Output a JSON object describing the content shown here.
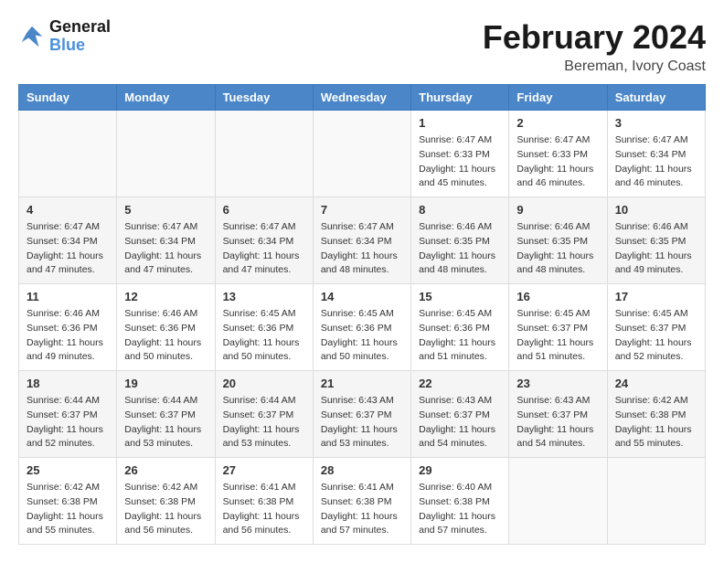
{
  "header": {
    "logo_line1": "General",
    "logo_line2": "Blue",
    "main_title": "February 2024",
    "subtitle": "Bereman, Ivory Coast"
  },
  "calendar": {
    "columns": [
      "Sunday",
      "Monday",
      "Tuesday",
      "Wednesday",
      "Thursday",
      "Friday",
      "Saturday"
    ],
    "weeks": [
      [
        {
          "day": "",
          "info": ""
        },
        {
          "day": "",
          "info": ""
        },
        {
          "day": "",
          "info": ""
        },
        {
          "day": "",
          "info": ""
        },
        {
          "day": "1",
          "info": "Sunrise: 6:47 AM\nSunset: 6:33 PM\nDaylight: 11 hours\nand 45 minutes."
        },
        {
          "day": "2",
          "info": "Sunrise: 6:47 AM\nSunset: 6:33 PM\nDaylight: 11 hours\nand 46 minutes."
        },
        {
          "day": "3",
          "info": "Sunrise: 6:47 AM\nSunset: 6:34 PM\nDaylight: 11 hours\nand 46 minutes."
        }
      ],
      [
        {
          "day": "4",
          "info": "Sunrise: 6:47 AM\nSunset: 6:34 PM\nDaylight: 11 hours\nand 47 minutes."
        },
        {
          "day": "5",
          "info": "Sunrise: 6:47 AM\nSunset: 6:34 PM\nDaylight: 11 hours\nand 47 minutes."
        },
        {
          "day": "6",
          "info": "Sunrise: 6:47 AM\nSunset: 6:34 PM\nDaylight: 11 hours\nand 47 minutes."
        },
        {
          "day": "7",
          "info": "Sunrise: 6:47 AM\nSunset: 6:34 PM\nDaylight: 11 hours\nand 48 minutes."
        },
        {
          "day": "8",
          "info": "Sunrise: 6:46 AM\nSunset: 6:35 PM\nDaylight: 11 hours\nand 48 minutes."
        },
        {
          "day": "9",
          "info": "Sunrise: 6:46 AM\nSunset: 6:35 PM\nDaylight: 11 hours\nand 48 minutes."
        },
        {
          "day": "10",
          "info": "Sunrise: 6:46 AM\nSunset: 6:35 PM\nDaylight: 11 hours\nand 49 minutes."
        }
      ],
      [
        {
          "day": "11",
          "info": "Sunrise: 6:46 AM\nSunset: 6:36 PM\nDaylight: 11 hours\nand 49 minutes."
        },
        {
          "day": "12",
          "info": "Sunrise: 6:46 AM\nSunset: 6:36 PM\nDaylight: 11 hours\nand 50 minutes."
        },
        {
          "day": "13",
          "info": "Sunrise: 6:45 AM\nSunset: 6:36 PM\nDaylight: 11 hours\nand 50 minutes."
        },
        {
          "day": "14",
          "info": "Sunrise: 6:45 AM\nSunset: 6:36 PM\nDaylight: 11 hours\nand 50 minutes."
        },
        {
          "day": "15",
          "info": "Sunrise: 6:45 AM\nSunset: 6:36 PM\nDaylight: 11 hours\nand 51 minutes."
        },
        {
          "day": "16",
          "info": "Sunrise: 6:45 AM\nSunset: 6:37 PM\nDaylight: 11 hours\nand 51 minutes."
        },
        {
          "day": "17",
          "info": "Sunrise: 6:45 AM\nSunset: 6:37 PM\nDaylight: 11 hours\nand 52 minutes."
        }
      ],
      [
        {
          "day": "18",
          "info": "Sunrise: 6:44 AM\nSunset: 6:37 PM\nDaylight: 11 hours\nand 52 minutes."
        },
        {
          "day": "19",
          "info": "Sunrise: 6:44 AM\nSunset: 6:37 PM\nDaylight: 11 hours\nand 53 minutes."
        },
        {
          "day": "20",
          "info": "Sunrise: 6:44 AM\nSunset: 6:37 PM\nDaylight: 11 hours\nand 53 minutes."
        },
        {
          "day": "21",
          "info": "Sunrise: 6:43 AM\nSunset: 6:37 PM\nDaylight: 11 hours\nand 53 minutes."
        },
        {
          "day": "22",
          "info": "Sunrise: 6:43 AM\nSunset: 6:37 PM\nDaylight: 11 hours\nand 54 minutes."
        },
        {
          "day": "23",
          "info": "Sunrise: 6:43 AM\nSunset: 6:37 PM\nDaylight: 11 hours\nand 54 minutes."
        },
        {
          "day": "24",
          "info": "Sunrise: 6:42 AM\nSunset: 6:38 PM\nDaylight: 11 hours\nand 55 minutes."
        }
      ],
      [
        {
          "day": "25",
          "info": "Sunrise: 6:42 AM\nSunset: 6:38 PM\nDaylight: 11 hours\nand 55 minutes."
        },
        {
          "day": "26",
          "info": "Sunrise: 6:42 AM\nSunset: 6:38 PM\nDaylight: 11 hours\nand 56 minutes."
        },
        {
          "day": "27",
          "info": "Sunrise: 6:41 AM\nSunset: 6:38 PM\nDaylight: 11 hours\nand 56 minutes."
        },
        {
          "day": "28",
          "info": "Sunrise: 6:41 AM\nSunset: 6:38 PM\nDaylight: 11 hours\nand 57 minutes."
        },
        {
          "day": "29",
          "info": "Sunrise: 6:40 AM\nSunset: 6:38 PM\nDaylight: 11 hours\nand 57 minutes."
        },
        {
          "day": "",
          "info": ""
        },
        {
          "day": "",
          "info": ""
        }
      ]
    ]
  }
}
